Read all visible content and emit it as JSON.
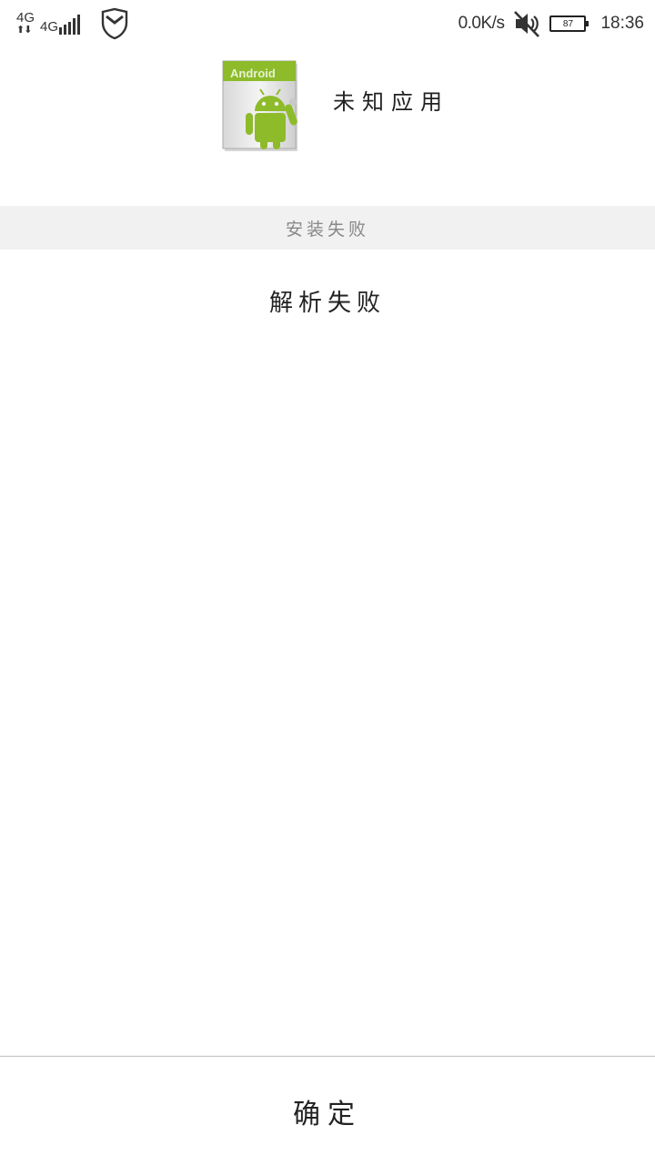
{
  "status_bar": {
    "network_1": "4G",
    "network_2": "4G",
    "data_arrows": "⬆⬇",
    "speed": "0.0K/s",
    "battery_level": "87",
    "time": "18:36",
    "icons": [
      "shield-icon",
      "mute-icon",
      "battery-icon",
      "signal-icon"
    ]
  },
  "app": {
    "icon_banner_text": "Android",
    "name": "未知应用"
  },
  "install_status": "安装失败",
  "error_message": "解析失败",
  "confirm_label": "确定",
  "colors": {
    "android_green": "#8dbb2a",
    "band_background": "#f1f1f1",
    "divider": "#bdbdbd"
  }
}
